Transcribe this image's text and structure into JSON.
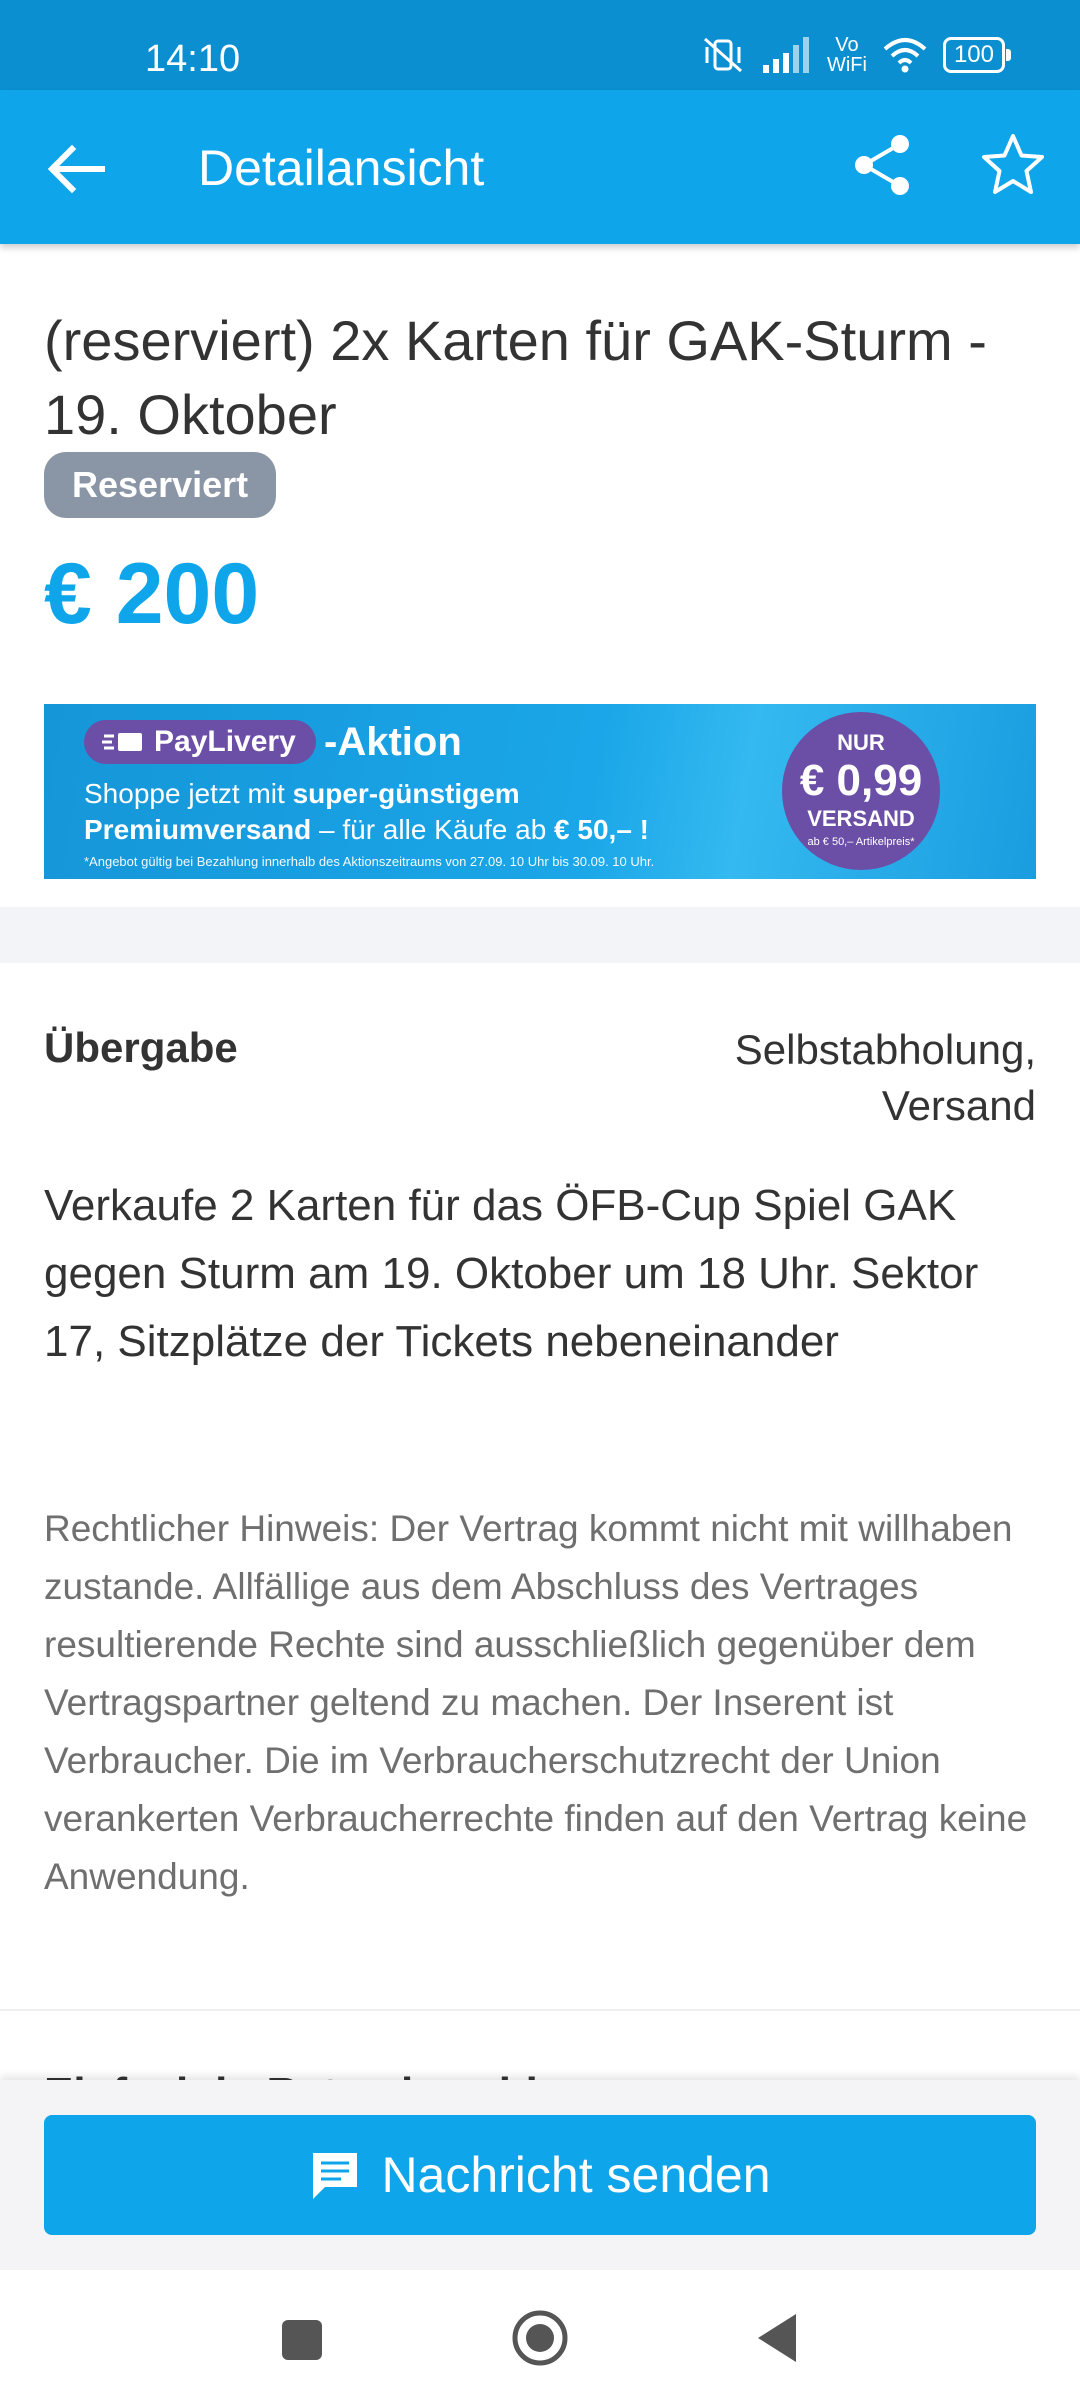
{
  "status_bar": {
    "time": "14:10",
    "vo_top": "Vo",
    "vo_bottom": "WiFi",
    "battery": "100"
  },
  "app_bar": {
    "title": "Detailansicht",
    "back_icon": "arrow-left-icon",
    "share_icon": "share-icon",
    "favorite_icon": "star-outline-icon"
  },
  "ad": {
    "title": "(reserviert) 2x Karten für GAK-Sturm - 19. Oktober",
    "badge": "Reserviert",
    "price": "€ 200"
  },
  "banner": {
    "brand": "PayLivery",
    "aktion": "-Aktion",
    "line1_prefix": "Shoppe jetzt mit ",
    "line1_bold": "super-günstigem",
    "line2_bold": "Premiumversand",
    "line2_mid": " – für alle Käufe ab ",
    "line2_bold2": "€ 50,– !",
    "fineprint": "*Angebot gültig bei Bezahlung innerhalb des Aktionszeitraums von 27.09. 10 Uhr bis 30.09. 10 Uhr.",
    "circle_nur": "NUR",
    "circle_amount": "€ 0,99",
    "circle_versand": "VERSAND",
    "circle_small": "ab € 50,– Artikelpreis*"
  },
  "details": {
    "uebergabe_label": "Übergabe",
    "uebergabe_value_1": "Selbstabholung,",
    "uebergabe_value_2": "Versand",
    "description": "Verkaufe 2 Karten für das ÖFB-Cup Spiel GAK gegen Sturm am 19. Oktober um 18 Uhr. Sektor 17, Sitzplätze der Tickets nebeneinander",
    "legal": "Rechtlicher Hinweis: Der Vertrag kommt nicht mit willhaben zustande. Allfällige aus dem Abschluss des Vertrages resultierende Rechte sind ausschließlich gegenüber dem Vertragspartner geltend zu machen. Der Inserent ist Verbraucher. Die im Verbraucherschutzrecht der Union verankerten Verbraucherrechte finden auf den Vertrag keine Anwendung.",
    "next_heading_partial": "Einfach in Raten bezahlen"
  },
  "cta": {
    "label": "Nachricht senden",
    "icon": "chat-message-icon"
  },
  "colors": {
    "status_bar": "#0b8fd0",
    "app_bar": "#0ea5ea",
    "price": "#0ea5ea",
    "badge": "#8a95a5",
    "banner_purple": "#6b4ea6"
  }
}
